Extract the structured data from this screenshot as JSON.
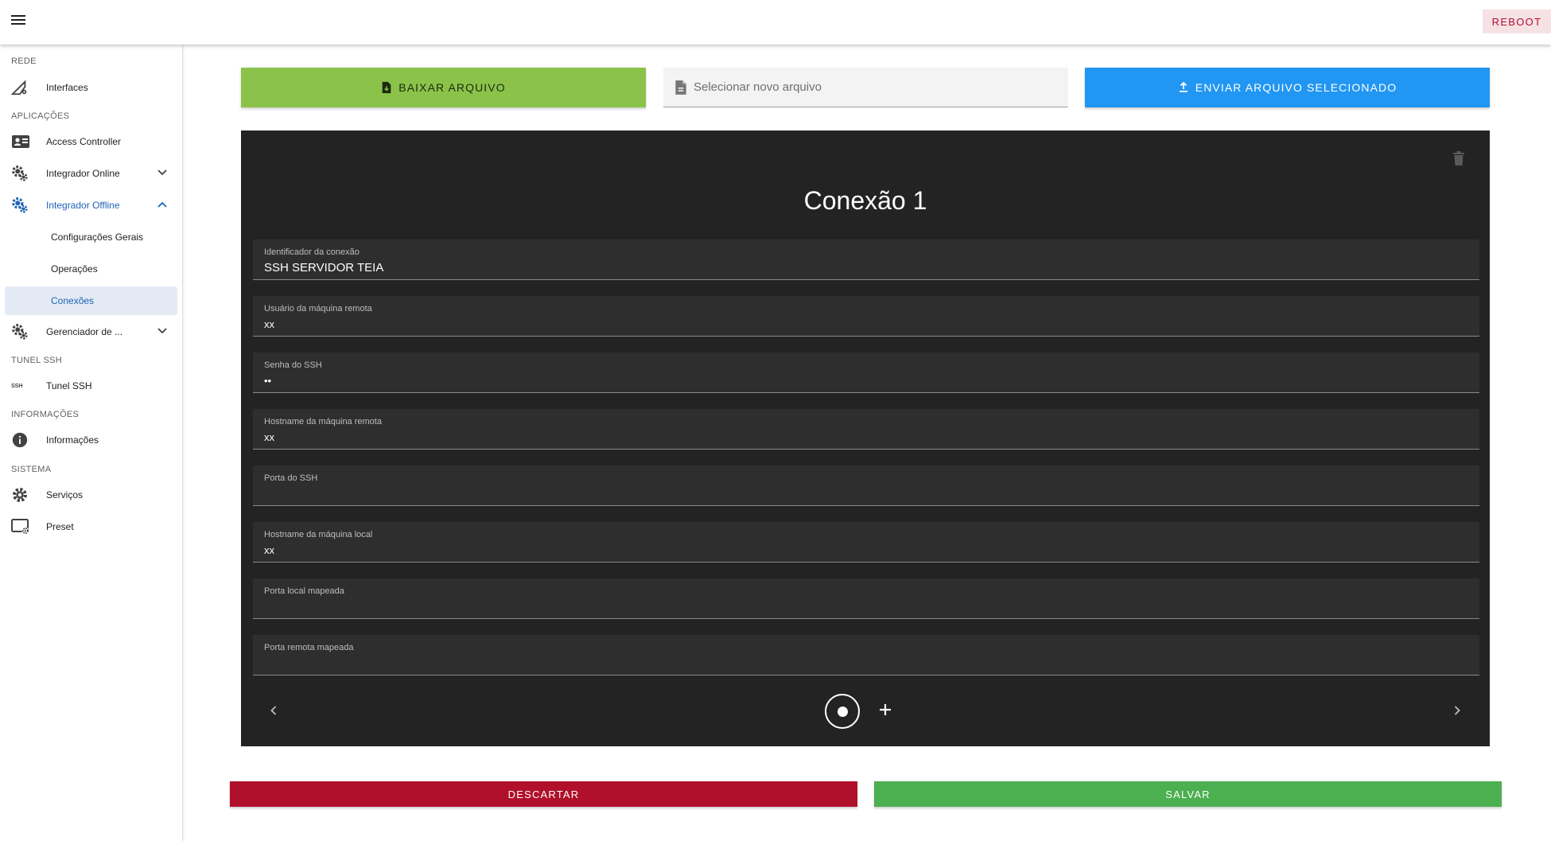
{
  "topbar": {
    "reboot_label": "REBOOT"
  },
  "sidebar": {
    "sections": {
      "rede": "REDE",
      "aplicacoes": "APLICAÇÕES",
      "tunel": "TUNEL SSH",
      "informacoes": "INFORMAÇÕES",
      "sistema": "SISTEMA"
    },
    "items": {
      "interfaces": "Interfaces",
      "access_controller": "Access Controller",
      "integrador_online": "Integrador Online",
      "integrador_offline": "Integrador Offline",
      "configuracoes_gerais": "Configurações Gerais",
      "operacoes": "Operações",
      "conexoes": "Conexões",
      "gerenciador": "Gerenciador de ...",
      "tunel_ssh": "Tunel SSH",
      "informacoes": "Informações",
      "servicos": "Serviços",
      "preset": "Preset"
    },
    "ssh_icon_text": "SSH"
  },
  "toolbar": {
    "download_label": "BAIXAR ARQUIVO",
    "file_placeholder": "Selecionar novo arquivo",
    "upload_label": "ENVIAR ARQUIVO SELECIONADO"
  },
  "card": {
    "title": "Conexão 1",
    "fields": [
      {
        "label": "Identificador da conexão",
        "value": "SSH SERVIDOR TEIA"
      },
      {
        "label": "Usuário da máquina remota",
        "value": "xx"
      },
      {
        "label": "Senha do SSH",
        "value": "••"
      },
      {
        "label": "Hostname da máquina remota",
        "value": "xx"
      },
      {
        "label": "Porta do SSH",
        "value": ""
      },
      {
        "label": "Hostname da máquina local",
        "value": "xx"
      },
      {
        "label": "Porta local mapeada",
        "value": ""
      },
      {
        "label": "Porta remota mapeada",
        "value": ""
      }
    ]
  },
  "actions": {
    "discard_label": "DESCARTAR",
    "save_label": "SALVAR"
  },
  "colors": {
    "accent_blue": "#1e63b6",
    "download_green": "#8bc34a",
    "upload_blue": "#2196f3",
    "discard_red": "#b0102b",
    "save_green": "#4caf50",
    "card_bg": "#232323"
  }
}
